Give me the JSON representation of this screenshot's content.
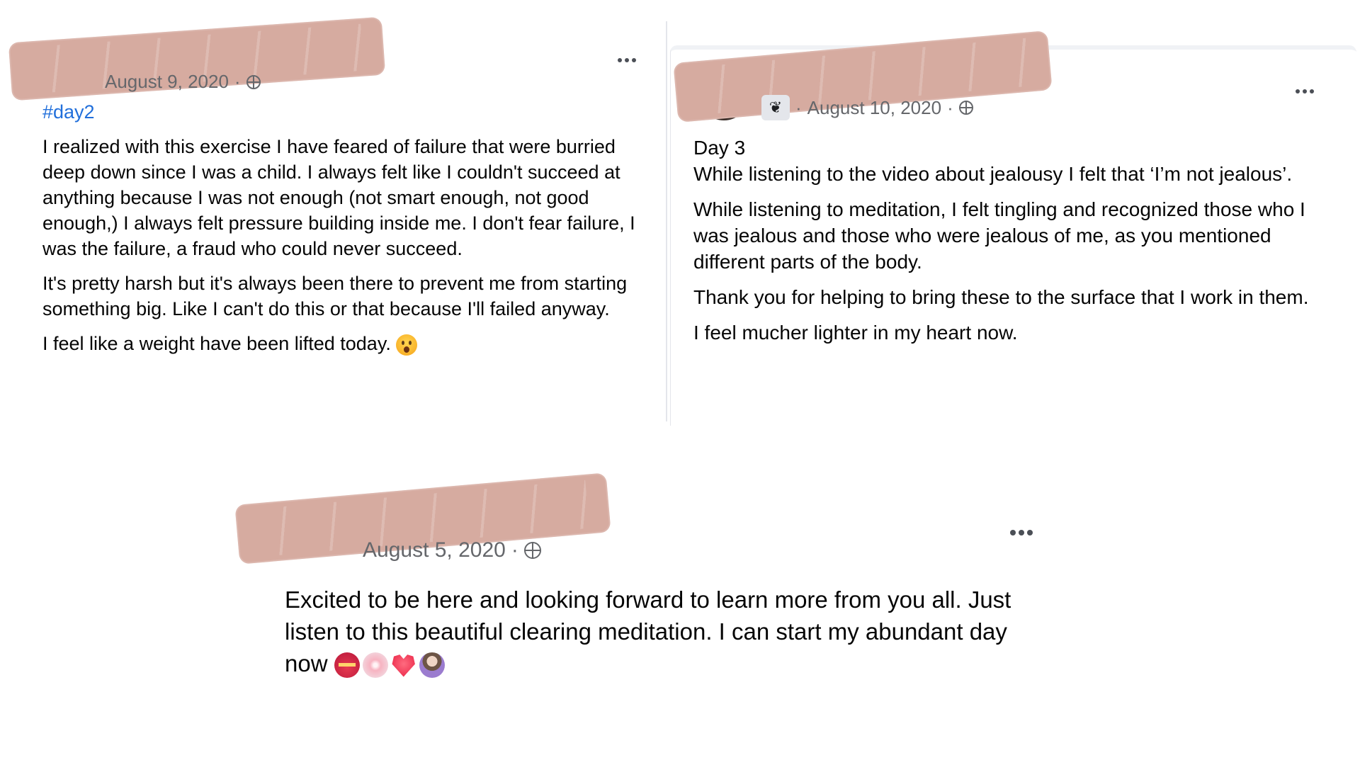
{
  "posts": [
    {
      "date": "August 9, 2020",
      "hashtag": "#day2",
      "paragraphs": [
        "I realized with this exercise I have feared of failure that were burried deep down since I was a child. I always felt like I couldn't succeed at anything because I was not enough (not smart enough, not good enough,) I always felt pressure building inside me. I don't fear failure, I was the failure, a fraud who could never succeed.",
        "It's pretty harsh but it's always been there to prevent me from starting something big. Like I can't do this or that because I'll failed anyway.",
        "I feel like a weight have been lifted today."
      ],
      "icons": {
        "privacy": "globe-icon",
        "more": "more-options-icon",
        "reaction": "surprised-face-emoji"
      }
    },
    {
      "date": "August 10, 2020",
      "title": "Day 3",
      "paragraphs": [
        "While listening to the video about jealousy I felt that ‘I’m not jealous’.",
        "While listening to meditation, I felt tingling and recognized those who I was jealous and those who were jealous of me, as you mentioned different parts of the body.",
        "Thank you for helping to bring these to the surface that I work in them.",
        "I feel mucher lighter in my heart now."
      ],
      "icons": {
        "badge": "sprout-icon",
        "privacy": "globe-icon",
        "more": "more-options-icon"
      }
    },
    {
      "date": "August 5, 2020",
      "paragraphs": [
        "Excited to be here and looking forward to learn more from you all. Just listen to this beautiful clearing meditation. I can start my abundant day now"
      ],
      "icons": {
        "privacy": "globe-icon",
        "more": "more-options-icon",
        "emojis": [
          "heart-with-ribbon-emoji",
          "cherry-blossom-emoji",
          "red-heart-emoji",
          "person-raising-hand-emoji"
        ]
      }
    }
  ],
  "separator": "·",
  "colors": {
    "text": "#050505",
    "meta": "#65676b",
    "link": "#216fdb",
    "redaction": "#d6aba0"
  }
}
